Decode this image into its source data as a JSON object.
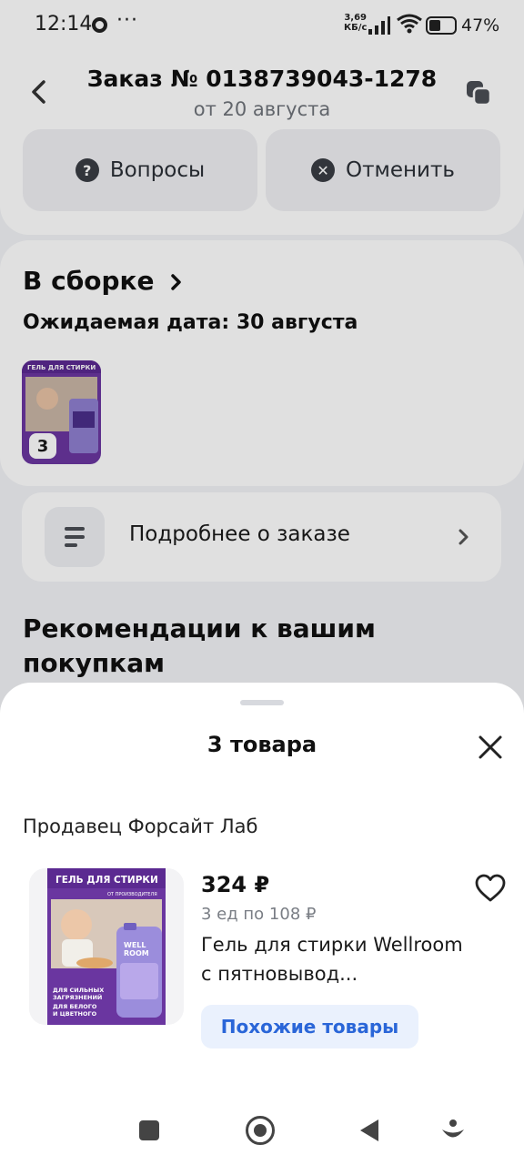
{
  "status_bar": {
    "time": "12:14",
    "dots": "···",
    "speed_value": "3,69",
    "speed_unit": "КБ/с",
    "battery": "47%"
  },
  "header": {
    "title": "Заказ № 0138739043-1278",
    "subtitle": "от 20 августа",
    "questions_label": "Вопросы",
    "questions_icon_glyph": "?",
    "cancel_label": "Отменить",
    "cancel_icon_glyph": "✕"
  },
  "order_status": {
    "title": "В сборке",
    "expected_date": "Ожидаемая дата: 30 августа",
    "quantity": "3"
  },
  "details": {
    "label": "Подробнее о заказе"
  },
  "recommendations": {
    "title": "Рекомендации к вашим покупкам"
  },
  "sheet": {
    "title": "3 товара",
    "seller": "Продавец Форсайт Лаб",
    "product": {
      "price": "324 ₽",
      "unit_price": "3 ед по 108 ₽",
      "name": "Гель для стирки Wellroom с пятновывод...",
      "similar_label": "Похожие товары"
    }
  },
  "product_image": {
    "banner": "ГЕЛЬ ДЛЯ СТИРКИ",
    "sub_banner": "ОТ ПРОИЗВОДИТЕЛЯ",
    "brand_line1": "WELL",
    "brand_line2": "ROOM",
    "caption_line1": "ДЛЯ СИЛЬНЫХ",
    "caption_line2": "ЗАГРЯЗНЕНИЙ",
    "caption_line3": "ДЛЯ БЕЛОГО",
    "caption_line4": "И ЦВЕТНОГО"
  },
  "colors": {
    "accent_blue": "#2a66d8",
    "product_purple": "#5b2a91",
    "text_secondary": "#6f737a"
  }
}
